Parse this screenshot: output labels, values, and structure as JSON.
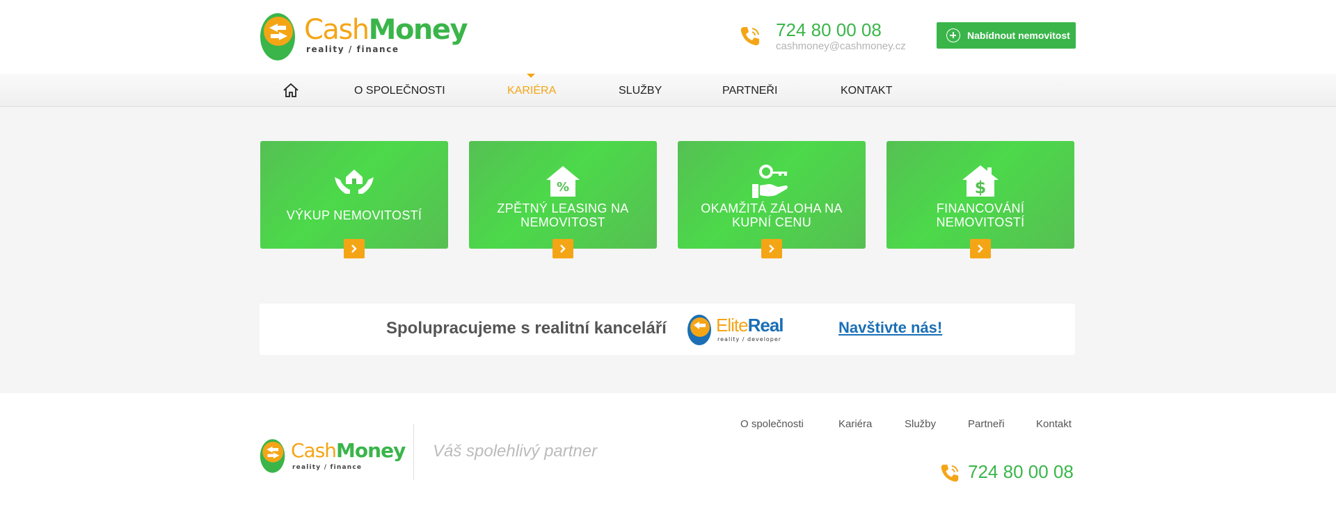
{
  "colors": {
    "brand_green": "#3ab54a",
    "brand_orange": "#f4a516",
    "elite_blue": "#1a6fb5"
  },
  "header": {
    "logo": {
      "cash": "Cash",
      "money": "Money",
      "subtitle": "reality / finance"
    },
    "phone": "724 80 00 08",
    "email": "cashmoney@cashmoney.cz",
    "offer_button": "Nabídnout nemovitost"
  },
  "nav": {
    "home_icon": "home-icon",
    "items": [
      {
        "label": "O SPOLEČNOSTI",
        "active": false
      },
      {
        "label": "KARIÉRA",
        "active": true
      },
      {
        "label": "SLUŽBY",
        "active": false
      },
      {
        "label": "PARTNEŘI",
        "active": false
      },
      {
        "label": "KONTAKT",
        "active": false
      }
    ]
  },
  "cards": [
    {
      "icon": "house-in-hands-icon",
      "title_lines": [
        "VÝKUP NEMOVITOSTÍ"
      ]
    },
    {
      "icon": "house-percent-icon",
      "title_lines": [
        "ZPĚTNÝ LEASING NA",
        "NEMOVITOST"
      ]
    },
    {
      "icon": "key-in-hand-icon",
      "title_lines": [
        "OKAMŽITÁ ZÁLOHA NA",
        "KUPNÍ CENU"
      ]
    },
    {
      "icon": "house-dollar-icon",
      "title_lines": [
        "FINANCOVÁNÍ",
        "NEMOVITOSTÍ"
      ]
    }
  ],
  "partner": {
    "text": "Spolupracujeme s realitní kanceláří",
    "logo": {
      "elite": "Elite",
      "real": "Real",
      "subtitle": "reality / developer"
    },
    "link": "Navštivte nás!"
  },
  "footer": {
    "logo": {
      "cash": "Cash",
      "money": "Money",
      "subtitle": "reality / finance"
    },
    "tagline": "Váš spolehlivý partner",
    "links": [
      "O společnosti",
      "Kariéra",
      "Služby",
      "Partneři",
      "Kontakt"
    ],
    "phone": "724 80 00 08"
  }
}
